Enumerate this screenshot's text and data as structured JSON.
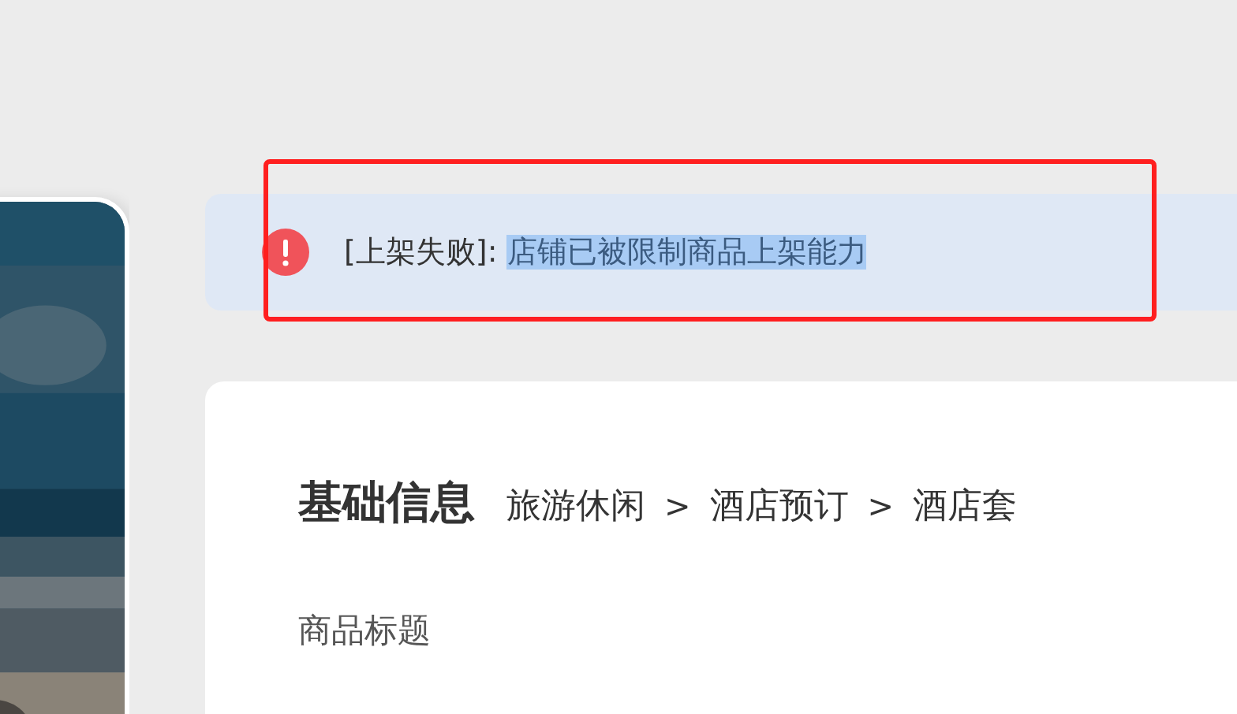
{
  "alert": {
    "label": "[上架失败]: ",
    "message": "店铺已被限制商品上架能力",
    "selected": true
  },
  "section": {
    "title": "基础信息",
    "breadcrumb": [
      {
        "kind": "crumb",
        "text": "旅游休闲"
      },
      {
        "kind": "separator",
        "text": ">"
      },
      {
        "kind": "crumb",
        "text": "酒店预订"
      },
      {
        "kind": "separator",
        "text": ">"
      },
      {
        "kind": "crumb",
        "text": "酒店套"
      }
    ]
  },
  "fields": [
    {
      "label": "商品标题"
    }
  ]
}
